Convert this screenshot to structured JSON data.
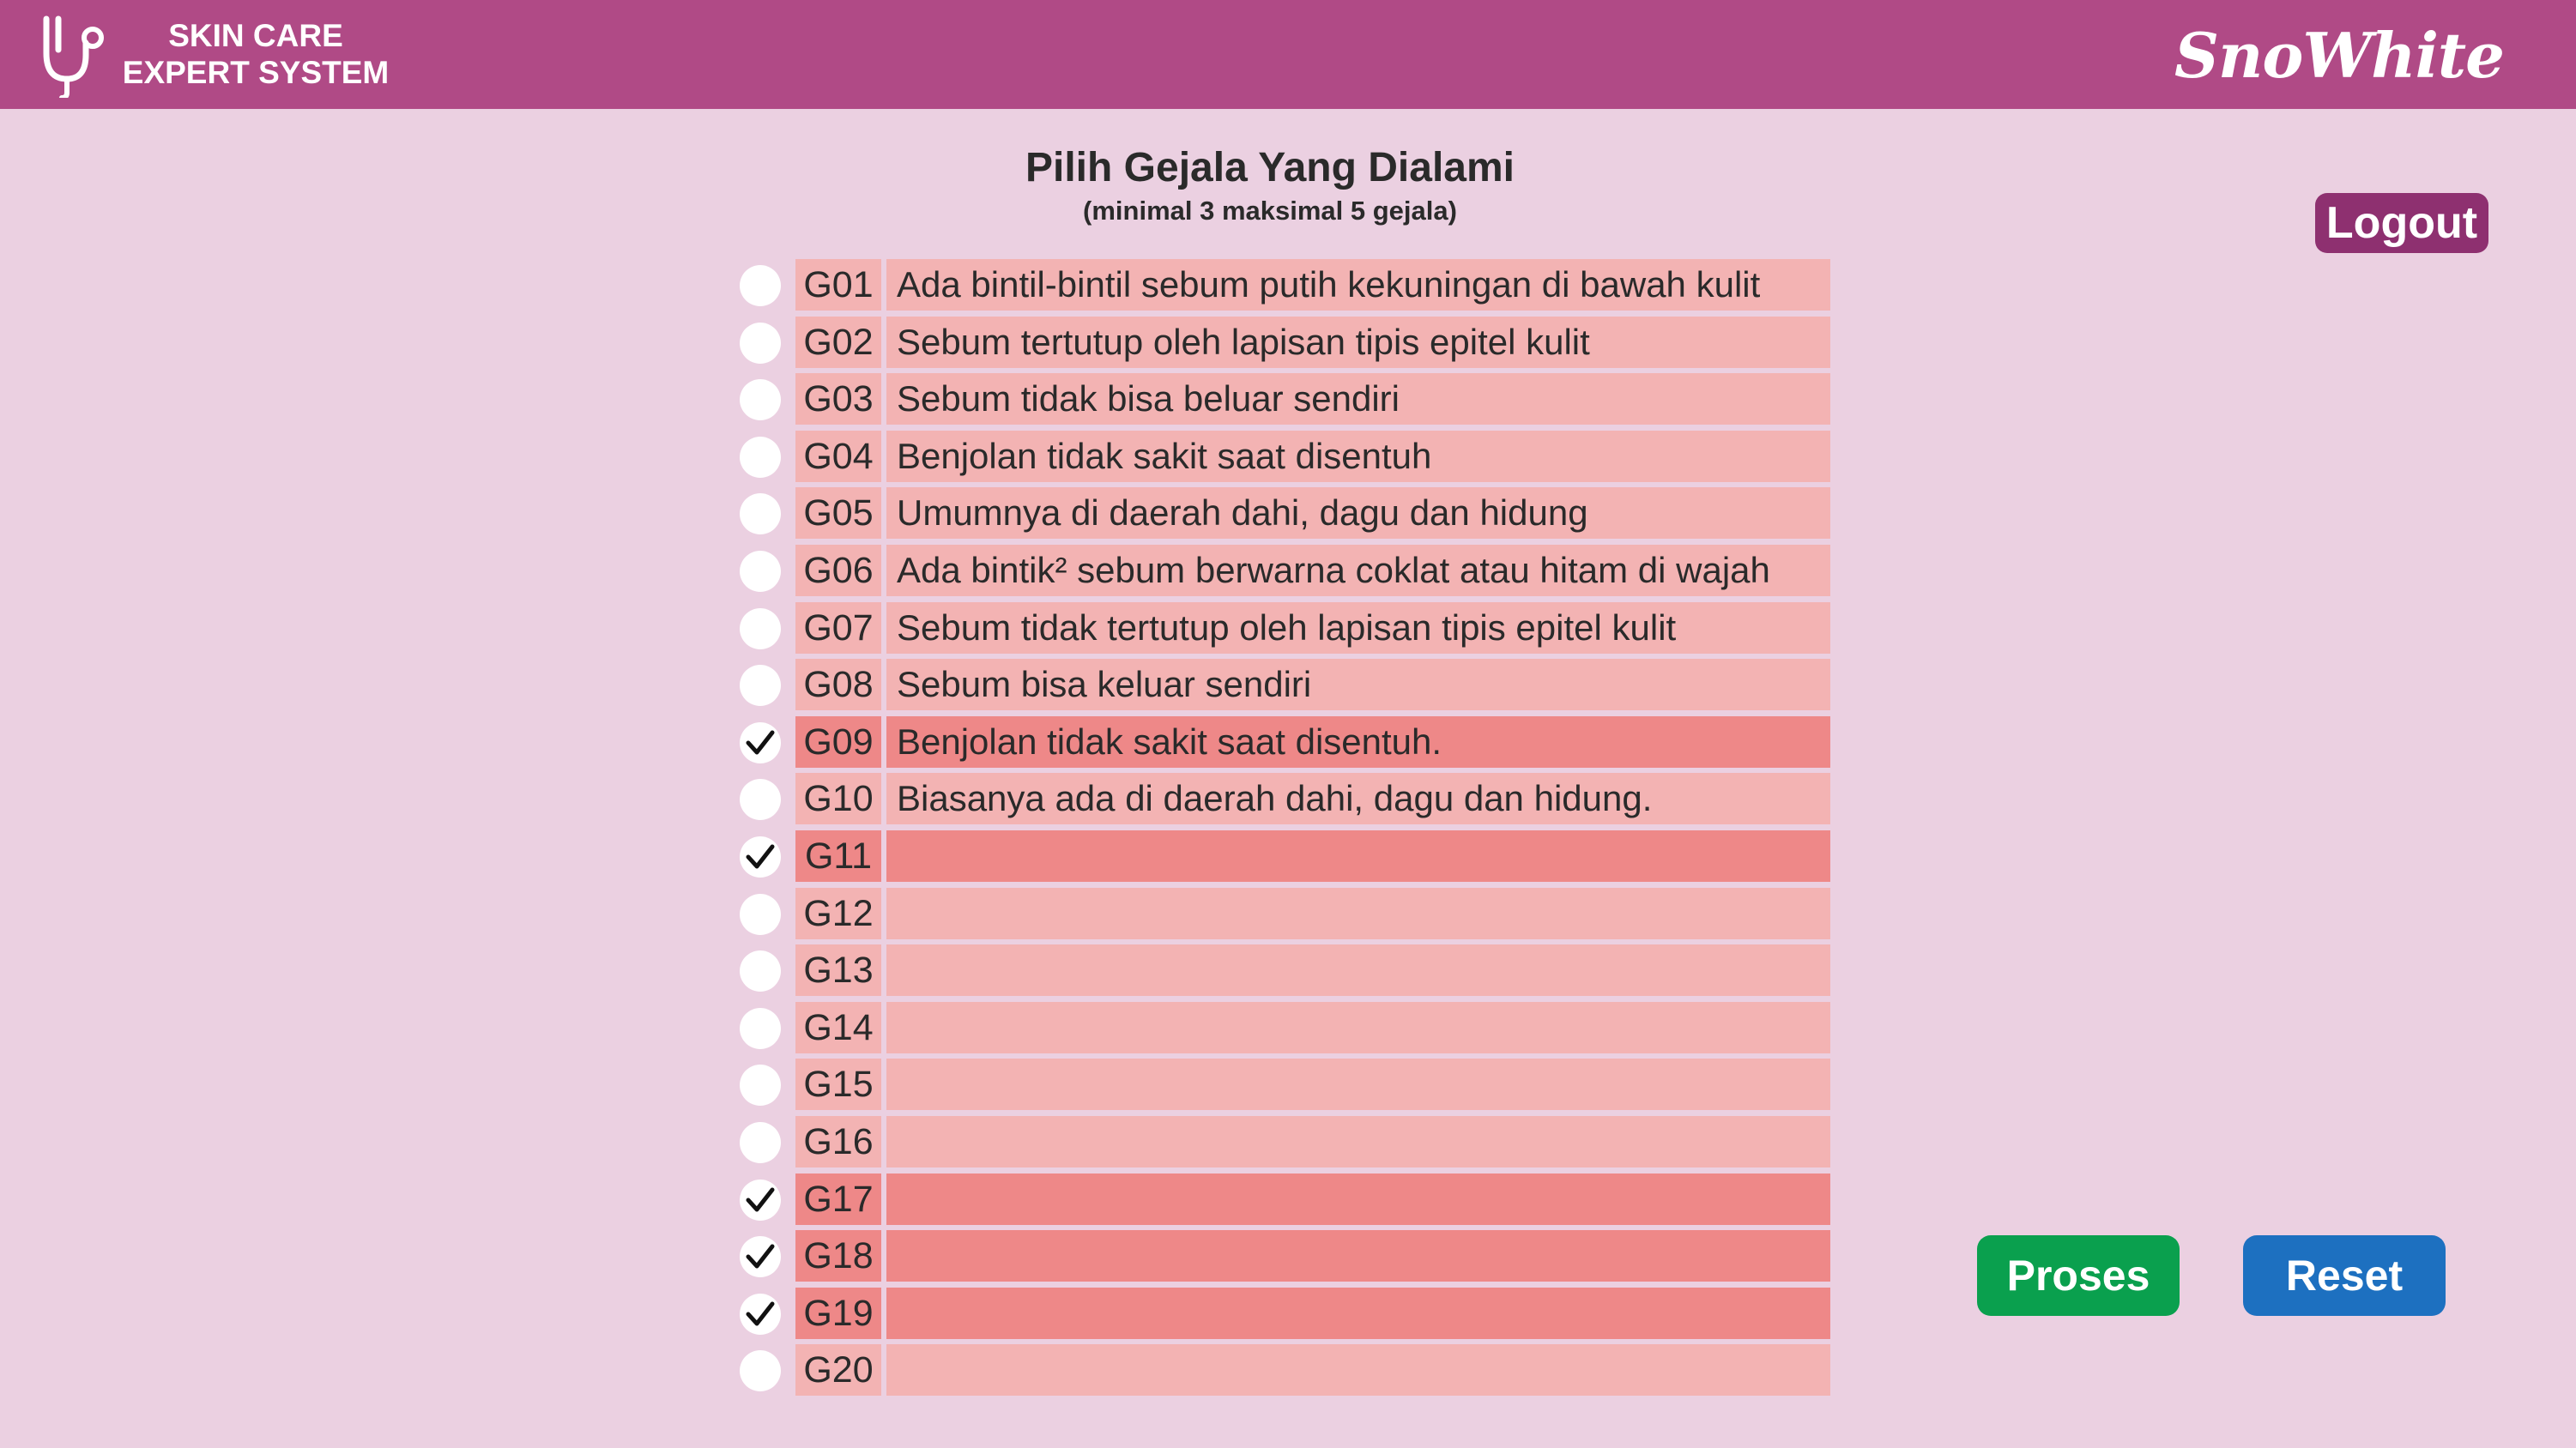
{
  "header": {
    "app_title_line1": "SKIN CARE",
    "app_title_line2": "EXPERT SYSTEM",
    "brand": "SnoWhite",
    "logo_icon": "stethoscope-icon",
    "color": "#b04a86"
  },
  "page": {
    "title": "Pilih Gejala Yang Dialami",
    "subtitle": "(minimal 3 maksimal 5 gejala)"
  },
  "logout_label": "Logout",
  "symptoms": [
    {
      "code": "G01",
      "desc": "Ada bintil-bintil sebum putih kekuningan di bawah kulit",
      "selected": false
    },
    {
      "code": "G02",
      "desc": "Sebum tertutup oleh lapisan tipis epitel kulit",
      "selected": false
    },
    {
      "code": "G03",
      "desc": "Sebum tidak bisa beluar sendiri",
      "selected": false
    },
    {
      "code": "G04",
      "desc": "Benjolan tidak sakit saat disentuh",
      "selected": false
    },
    {
      "code": "G05",
      "desc": "Umumnya di daerah dahi, dagu dan hidung",
      "selected": false
    },
    {
      "code": "G06",
      "desc": "Ada bintik² sebum berwarna coklat atau hitam di wajah",
      "selected": false
    },
    {
      "code": "G07",
      "desc": "Sebum tidak tertutup oleh lapisan tipis epitel kulit",
      "selected": false
    },
    {
      "code": "G08",
      "desc": "Sebum bisa keluar sendiri",
      "selected": false
    },
    {
      "code": "G09",
      "desc": "Benjolan tidak sakit saat disentuh.",
      "selected": true
    },
    {
      "code": "G10",
      "desc": "Biasanya ada di daerah dahi, dagu dan hidung.",
      "selected": false
    },
    {
      "code": "G11",
      "desc": "",
      "selected": true
    },
    {
      "code": "G12",
      "desc": "",
      "selected": false
    },
    {
      "code": "G13",
      "desc": "",
      "selected": false
    },
    {
      "code": "G14",
      "desc": "",
      "selected": false
    },
    {
      "code": "G15",
      "desc": "",
      "selected": false
    },
    {
      "code": "G16",
      "desc": "",
      "selected": false
    },
    {
      "code": "G17",
      "desc": "",
      "selected": true
    },
    {
      "code": "G18",
      "desc": "",
      "selected": true
    },
    {
      "code": "G19",
      "desc": "",
      "selected": true
    },
    {
      "code": "G20",
      "desc": "",
      "selected": false
    }
  ],
  "actions": {
    "proses_label": "Proses",
    "reset_label": "Reset"
  },
  "colors": {
    "background": "#ebd0e1",
    "row_default": "#f3b3b3",
    "row_selected": "#ee8888",
    "proses": "#0aa04e",
    "reset": "#1d70c0",
    "logout": "#8e3070"
  }
}
